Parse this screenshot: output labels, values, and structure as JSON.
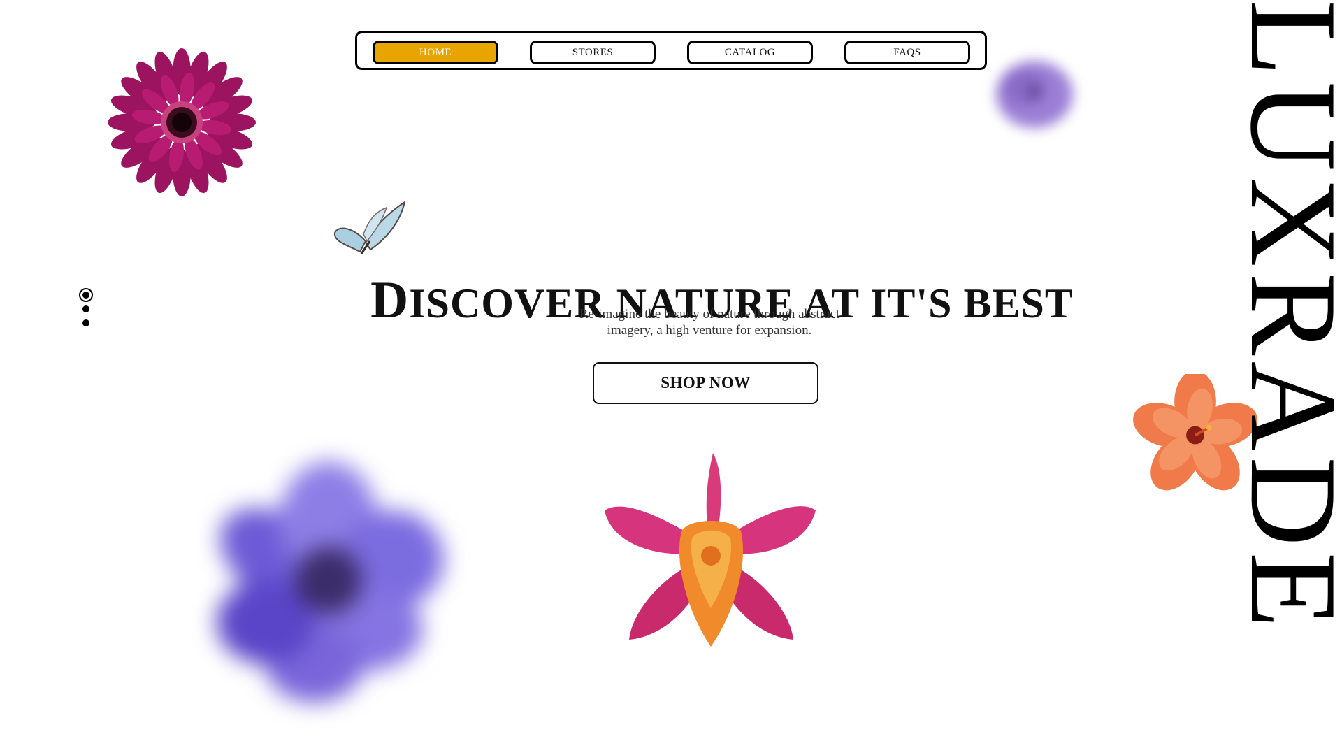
{
  "nav": {
    "items": [
      {
        "label": "HOME",
        "active": true
      },
      {
        "label": "STORES",
        "active": false
      },
      {
        "label": "CATALOG",
        "active": false
      },
      {
        "label": "FAQS",
        "active": false
      }
    ],
    "active_color": "#e8a500"
  },
  "hero": {
    "title_first_letter": "D",
    "title_rest": "ISCOVER NATURE AT IT'S BEST",
    "subtitle_line1": "Re-imagine the beauty of nature through abstract",
    "subtitle_line2": "imagery, a high venture for expansion.",
    "cta_label": "SHOP NOW"
  },
  "slider": {
    "count": 3,
    "active_index": 1
  },
  "brand": {
    "name": "LUXRADE"
  },
  "decorations": {
    "icons": [
      "gerbera-flower-image",
      "blurred-purple-flower-image",
      "butterfly-image",
      "blurred-anemone-image",
      "orchid-image",
      "hibiscus-image"
    ]
  }
}
